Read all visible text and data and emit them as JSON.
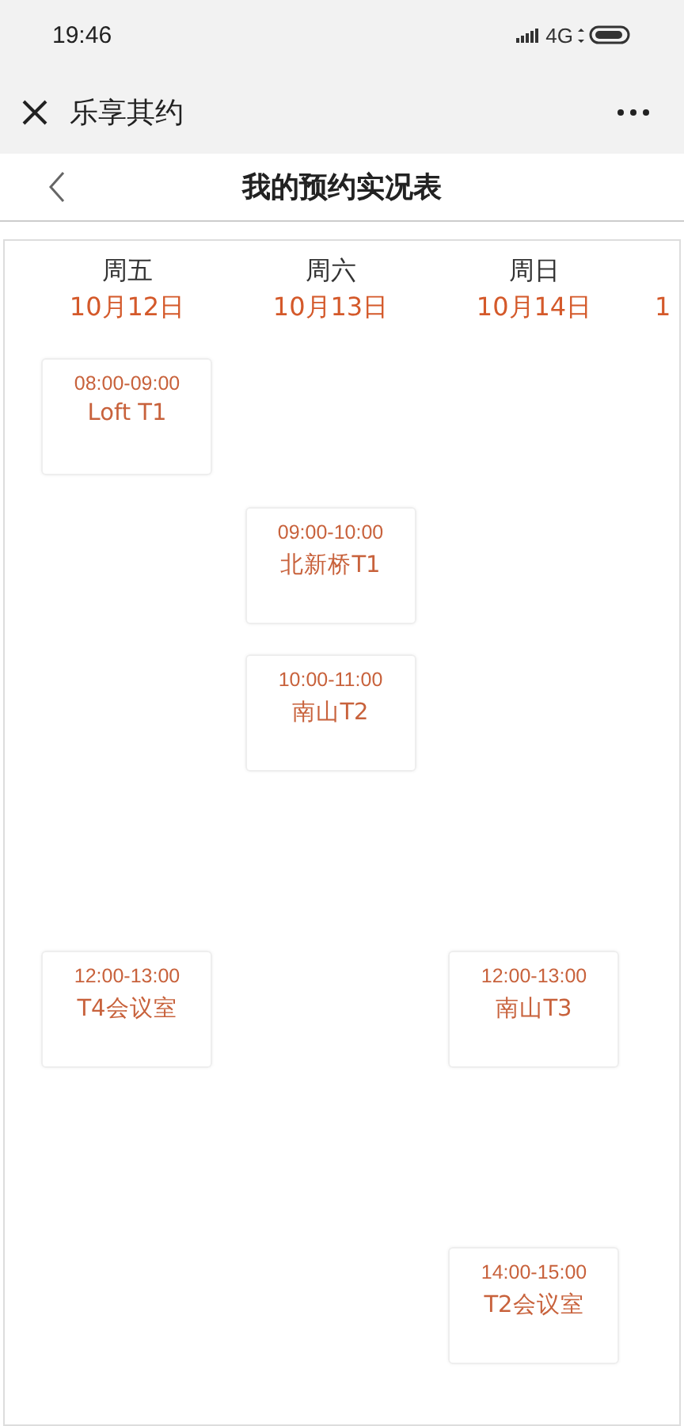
{
  "status_bar": {
    "time": "19:46",
    "network": "4G"
  },
  "nav_bar": {
    "title": "乐享其约"
  },
  "header": {
    "title": "我的预约实况表"
  },
  "days": [
    {
      "weekday": "周五",
      "date": "10月12日"
    },
    {
      "weekday": "周六",
      "date": "10月13日"
    },
    {
      "weekday": "周日",
      "date": "10月14日"
    },
    {
      "date": "1"
    }
  ],
  "schedule": [
    {
      "cells": [
        {
          "time": "08:00-09:00",
          "place": "Loft T1"
        },
        null,
        null
      ]
    },
    {
      "cells": [
        null,
        {
          "time": "09:00-10:00",
          "place": "北新桥T1"
        },
        null
      ]
    },
    {
      "cells": [
        null,
        {
          "time": "10:00-11:00",
          "place": "南山T2"
        },
        null
      ]
    },
    {
      "cells": [
        null,
        null,
        null
      ]
    },
    {
      "cells": [
        {
          "time": "12:00-13:00",
          "place": "T4会议室"
        },
        null,
        {
          "time": "12:00-13:00",
          "place": "南山T3"
        }
      ]
    },
    {
      "cells": [
        null,
        null,
        null
      ]
    },
    {
      "cells": [
        null,
        null,
        {
          "time": "14:00-15:00",
          "place": "T2会议室"
        }
      ]
    }
  ]
}
